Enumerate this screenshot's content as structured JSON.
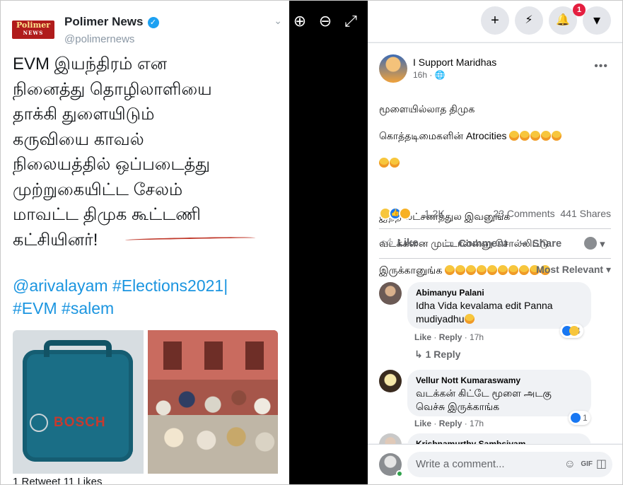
{
  "tweet": {
    "logo_text": "Polimer",
    "logo_sub": "NEWS",
    "name": "Polimer News",
    "handle": "@polimernews",
    "text_lines": [
      "EVM இயந்திரம் என",
      "நினைத்து தொழிலாளியை",
      "தாக்கி துளையிடும்",
      "கருவியை காவல்",
      "நிலையத்தில் ஒப்படைத்து",
      "முற்றுகையிட்ட சேலம்",
      "மாவட்ட திமுக கூட்டணி",
      "கட்சியினர்!"
    ],
    "hashtags_line1": "@arivalayam #Elections2021|",
    "hashtags_line2": "#EVM #salem",
    "image1_brand": "BOSCH",
    "stats": "1 Retweet   11 Likes",
    "colors": {
      "accent": "#1b95e0",
      "underline": "#c0392b"
    }
  },
  "viewer": {
    "zoom_in_icon": "⊕",
    "zoom_out_icon": "⊖",
    "expand_icon": "⤢"
  },
  "facebook": {
    "topbar": {
      "create_icon": "+",
      "messenger_icon": "⚡",
      "notif_icon": "🔔",
      "notif_count": "1",
      "menu_icon": "▾"
    },
    "post": {
      "author": "I Support Maridhas",
      "time": "16h · 🌐",
      "more": "•••",
      "text_p1a": "மூளையில்லாத திமுக",
      "text_p1b": "கொத்தடிமைகளின் Atrocities",
      "text_p2a": "இந்த லட்சணத்துல இவனுங்க",
      "text_p2b": "வடக்கனை முட்டாள்ன்னு சொல்லிட்டு",
      "text_p2c": "இருக்கானுங்க",
      "reaction_count": "1.2K",
      "comments": "23 Comments",
      "shares": "441 Shares",
      "actions": {
        "like": "Like",
        "comment": "Comment",
        "share": "Share"
      },
      "sort": "Most Relevant ▾"
    },
    "comments": [
      {
        "name": "Abimanyu Palani",
        "text": "Idha Vida kevalama edit Panna mudiyadhu",
        "like": "Like",
        "reply": "Reply",
        "time": "17h",
        "reactions": "4",
        "replies_link": "↳ 1 Reply"
      },
      {
        "name": "Vellur Nott Kumaraswamy",
        "text": "வடக்கன் கிட்டே மூளை அடகு வெச்சு இருக்காங்க",
        "like": "Like",
        "reply": "Reply",
        "time": "17h",
        "reactions": "1"
      },
      {
        "name": "Krishnamurthy Sambsivam"
      }
    ],
    "write_placeholder": "Write a comment..."
  }
}
